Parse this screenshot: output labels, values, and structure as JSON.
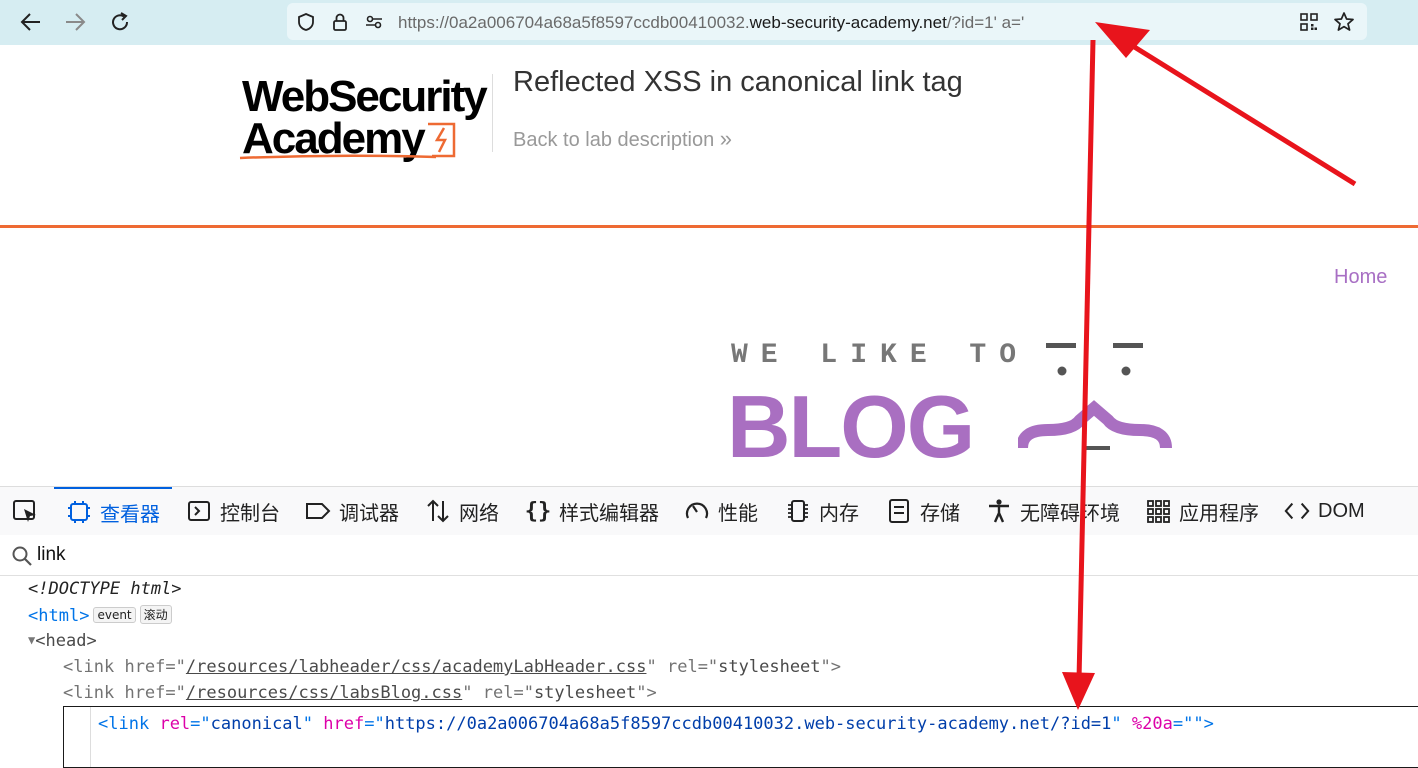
{
  "browser": {
    "url_prefix": "https://0a2a006704a68a5f8597ccdb00410032.",
    "url_host": "web-security-academy.net",
    "url_suffix": "/?id=1' a='"
  },
  "lab_header": {
    "logo_line1": "WebSecurity",
    "logo_line2": "Academy",
    "title": "Reflected XSS in canonical link tag",
    "back_link": "Back to lab description",
    "back_chevrons": "»"
  },
  "blog": {
    "home_link": "Home",
    "tagline": "WE LIKE TO",
    "logo_word": "BLOG"
  },
  "devtools": {
    "tabs": [
      {
        "label": "查看器",
        "icon": "inspector-icon"
      },
      {
        "label": "控制台",
        "icon": "console-icon"
      },
      {
        "label": "调试器",
        "icon": "debugger-icon"
      },
      {
        "label": "网络",
        "icon": "network-icon"
      },
      {
        "label": "样式编辑器",
        "icon": "style-editor-icon"
      },
      {
        "label": "性能",
        "icon": "performance-icon"
      },
      {
        "label": "内存",
        "icon": "memory-icon"
      },
      {
        "label": "存储",
        "icon": "storage-icon"
      },
      {
        "label": "无障碍环境",
        "icon": "accessibility-icon"
      },
      {
        "label": "应用程序",
        "icon": "application-icon"
      },
      {
        "label": "DOM",
        "icon": "dom-icon"
      }
    ],
    "search_value": "link",
    "tree": {
      "doctype": "<!DOCTYPE html>",
      "html_tag": "html",
      "badge_event": "event",
      "badge_scroll": "滚动",
      "head_tag": "head",
      "link1": {
        "tag": "link",
        "attr1": "href",
        "val1": "/resources/labheader/css/academyLabHeader.css",
        "attr2": "rel",
        "val2": "stylesheet"
      },
      "link2": {
        "tag": "link",
        "attr1": "href",
        "val1": "/resources/css/labsBlog.css",
        "attr2": "rel",
        "val2": "stylesheet"
      },
      "link3": {
        "tag": "link",
        "attr1": "rel",
        "val1": "canonical",
        "attr2": "href",
        "val2": "https://0a2a006704a68a5f8597ccdb00410032.web-security-academy.net/?id=1",
        "attr3": "%20a",
        "val3": ""
      }
    }
  },
  "colors": {
    "accent_orange": "#ee6a33",
    "blog_purple": "#a96fc1",
    "devtools_blue": "#0060df",
    "annotation_red": "#e8141c"
  }
}
